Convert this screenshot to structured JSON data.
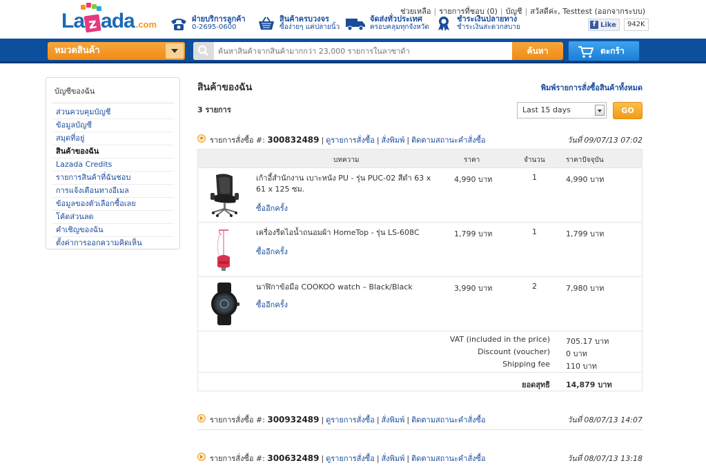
{
  "header": {
    "logo_text_1": "La",
    "logo_text_z": "z",
    "logo_text_2": "ada",
    "logo_dotcom": ".com",
    "features": [
      {
        "icon": "phone-icon",
        "line1": "ฝ่ายบริการลูกค้า",
        "line2": "0-2695-0600"
      },
      {
        "icon": "basket-icon",
        "line1": "สินค้าครบวงจร",
        "line2": "ซื้อง่ายๆ แค่ปลายนิ้ว"
      },
      {
        "icon": "truck-icon",
        "line1": "จัดส่งทั่วประเทศ",
        "line2": "ครอบคลุมทุกจังหวัด"
      },
      {
        "icon": "award-icon",
        "line1": "ชำระเงินปลายทาง",
        "line2": "ชำระเงินสะดวกสบาย"
      }
    ],
    "top_links": {
      "help": "ช่วยเหลือ",
      "wishlist": "รายการที่ชอบ (0)",
      "account": "บัญชี",
      "greeting": "สวัสดีค่ะ, Testtest (ออกจากระบบ)"
    },
    "fb_like": "Like",
    "fb_count": "942K"
  },
  "nav": {
    "category_label": "หมวดสินค้า",
    "search_placeholder": "ค้นหาสินค้าจากสินค้ามากกว่า 23,000 รายการในลาซาด้า",
    "search_button": "ค้นหา",
    "cart_button": "ตะกร้า"
  },
  "sidebar": {
    "title": "บัญชีของฉัน",
    "items": [
      {
        "label": "ส่วนควบคุมบัญชี",
        "active": false
      },
      {
        "label": "ข้อมูลบัญชี",
        "active": false
      },
      {
        "label": "สมุดที่อยู่",
        "active": false
      },
      {
        "label": "สินค้าของฉัน",
        "active": true
      },
      {
        "label": "Lazada Credits",
        "active": false
      },
      {
        "label": "รายการสินค้าที่ฉันชอบ",
        "active": false
      },
      {
        "label": "การแจ้งเตือนทางอีเมล",
        "active": false
      },
      {
        "label": "ข้อมูลของตัวเลือกซื้อเลย",
        "active": false
      },
      {
        "label": "โค้ดส่วนลด",
        "active": false
      },
      {
        "label": "คำเชิญของฉัน",
        "active": false
      },
      {
        "label": "ตั้งค่าการออกความคิดเห็น",
        "active": false
      }
    ]
  },
  "main": {
    "title": "สินค้าของฉัน",
    "print_all": "พิมพ์รายการสั่งซื้อสินค้าทั้งหมด",
    "count_label": "3 รายการ",
    "period_value": "Last 15 days",
    "go_button": "GO",
    "order_label": "รายการสั่งซื้อ #:",
    "action_view": "ดูรายการสั่งซื้อ",
    "action_print": "สั่งพิมพ์",
    "action_track": "ติดตามสถานะคำสั่งซื้อ",
    "columns": {
      "item": "บทความ",
      "price": "ราคา",
      "qty": "จำนวน",
      "current_price": "ราคาปัจจุบัน"
    },
    "reorder": "ซื้ออีกครั้ง",
    "orders": [
      {
        "number": "300832489",
        "date": "วันที่ 09/07/13 07:02",
        "expanded": true,
        "items": [
          {
            "name": "เก้าอี้สำนักงาน เบาะหนัง PU - รุ่น PUC-02 สีดำ 63 x 61 x 125 ซม.",
            "price": "4,990 บาท",
            "qty": "1",
            "total": "4,990 บาท",
            "image": "office-chair"
          },
          {
            "name": "เครื่องรีดไอน้ำถนอมผ้า HomeTop - รุ่น LS-608C",
            "price": "1,799 บาท",
            "qty": "1",
            "total": "1,799 บาท",
            "image": "garment-steamer"
          },
          {
            "name": "นาฬิกาข้อมือ COOKOO watch – Black/Black",
            "price": "3,990 บาท",
            "qty": "2",
            "total": "7,980 บาท",
            "image": "wrist-watch"
          }
        ],
        "summary": [
          {
            "label": "VAT (included in the price)",
            "value": "705.17 บาท"
          },
          {
            "label": "Discount (voucher)",
            "value": "0 บาท"
          },
          {
            "label": "Shipping fee",
            "value": "110 บาท"
          }
        ],
        "grand_label": "ยอดสุทธิ",
        "grand_value": "14,879 บาท"
      },
      {
        "number": "300932489",
        "date": "วันที่ 08/07/13 14:07",
        "expanded": false
      },
      {
        "number": "300632489",
        "date": "วันที่ 08/07/13 13:18",
        "expanded": false
      }
    ]
  },
  "colors": {
    "nav_blue": "#0d4f9d",
    "orange": "#f08c17",
    "link": "#1a4c9c"
  }
}
